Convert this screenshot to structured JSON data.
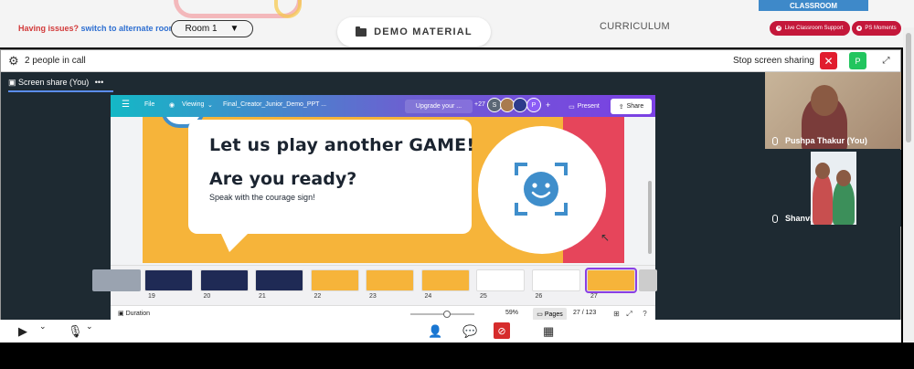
{
  "topbar": {
    "issues_text": "Having issues?",
    "issues_link": "switch to alternate room",
    "room_label": "Room 1",
    "room_arrow": "▼",
    "demo_label": "DEMO MATERIAL",
    "curriculum_label": "CURRICULUM",
    "classroom_label": "CLASSROOM",
    "live_support_label": "Live Classroom Support",
    "ps_moments_label": "PS Moments"
  },
  "call": {
    "people_text": "2 people in call",
    "stop_share_label": "Stop screen sharing",
    "close_glyph": "✕",
    "participant_badge": "P",
    "screen_share_tab": "Screen share (You)",
    "tab_menu": "•••"
  },
  "canva": {
    "menu_glyph": "☰",
    "file_label": "File",
    "viewing_label": "Viewing",
    "doc_title": "Final_Creator_Junior_Demo_PPT ...",
    "upgrade_label": "Upgrade your ...",
    "collab_count": "+27",
    "avatar_s": "S",
    "avatar_p": "P",
    "plus": "+",
    "present_label": "Present",
    "share_label": "Share"
  },
  "slide": {
    "heading": "Let us play another GAME!",
    "question": "Are you ready?",
    "subtext": "Speak with the courage sign!"
  },
  "thumbnails": [
    {
      "num": "19",
      "color": "#1f2a55"
    },
    {
      "num": "20",
      "color": "#1f2a55"
    },
    {
      "num": "21",
      "color": "#1f2a55"
    },
    {
      "num": "22",
      "color": "#f6b43a"
    },
    {
      "num": "23",
      "color": "#f6b43a"
    },
    {
      "num": "24",
      "color": "#f6b43a"
    },
    {
      "num": "25",
      "color": "#ffffff"
    },
    {
      "num": "26",
      "color": "#ffffff"
    },
    {
      "num": "27",
      "color": "#f6b43a"
    }
  ],
  "footer": {
    "duration_label": "Duration",
    "zoom": "59%",
    "pages_label": "Pages",
    "page_count": "27 / 123"
  },
  "participants": [
    {
      "name": "Pushpa Thakur (You)"
    },
    {
      "name": "Shanvi"
    }
  ],
  "colors": {
    "accent_red": "#c4173a",
    "classroom_blue": "#3e89c9",
    "slide_yellow": "#f6b43a",
    "slide_red": "#e6455b",
    "icon_blue": "#3f8ecb"
  }
}
